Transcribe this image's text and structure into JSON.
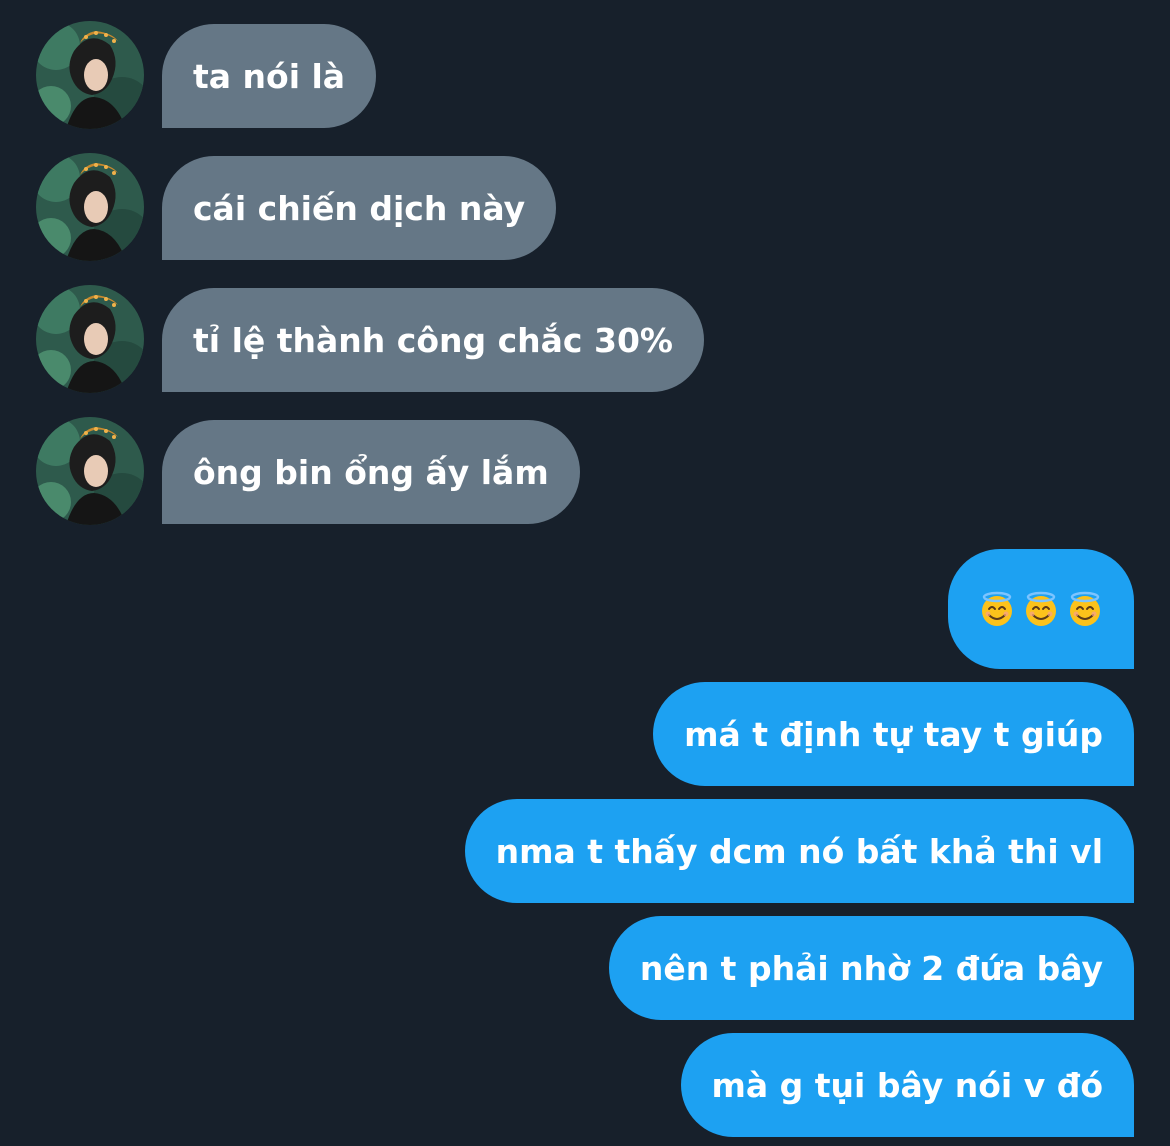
{
  "incoming": [
    {
      "text": "ta nói là"
    },
    {
      "text": "cái chiến dịch này"
    },
    {
      "text": "tỉ lệ thành công chắc 30%"
    },
    {
      "text": "ông bin ổng ấy lắm"
    }
  ],
  "outgoing": [
    {
      "emojis": [
        "smiling-face-with-halo-icon",
        "smiling-face-with-halo-icon",
        "smiling-face-with-halo-icon"
      ]
    },
    {
      "text": "má t định tự tay t giúp"
    },
    {
      "text": "nma t thấy dcm nó bất khả thi vl"
    },
    {
      "text": "nên t phải nhờ 2 đứa bây"
    },
    {
      "text": "mà g tụi bây nói v đó"
    }
  ],
  "colors": {
    "background": "#17202b",
    "incoming_bubble": "#657786",
    "outgoing_bubble": "#1da1f2",
    "text": "#ffffff"
  }
}
